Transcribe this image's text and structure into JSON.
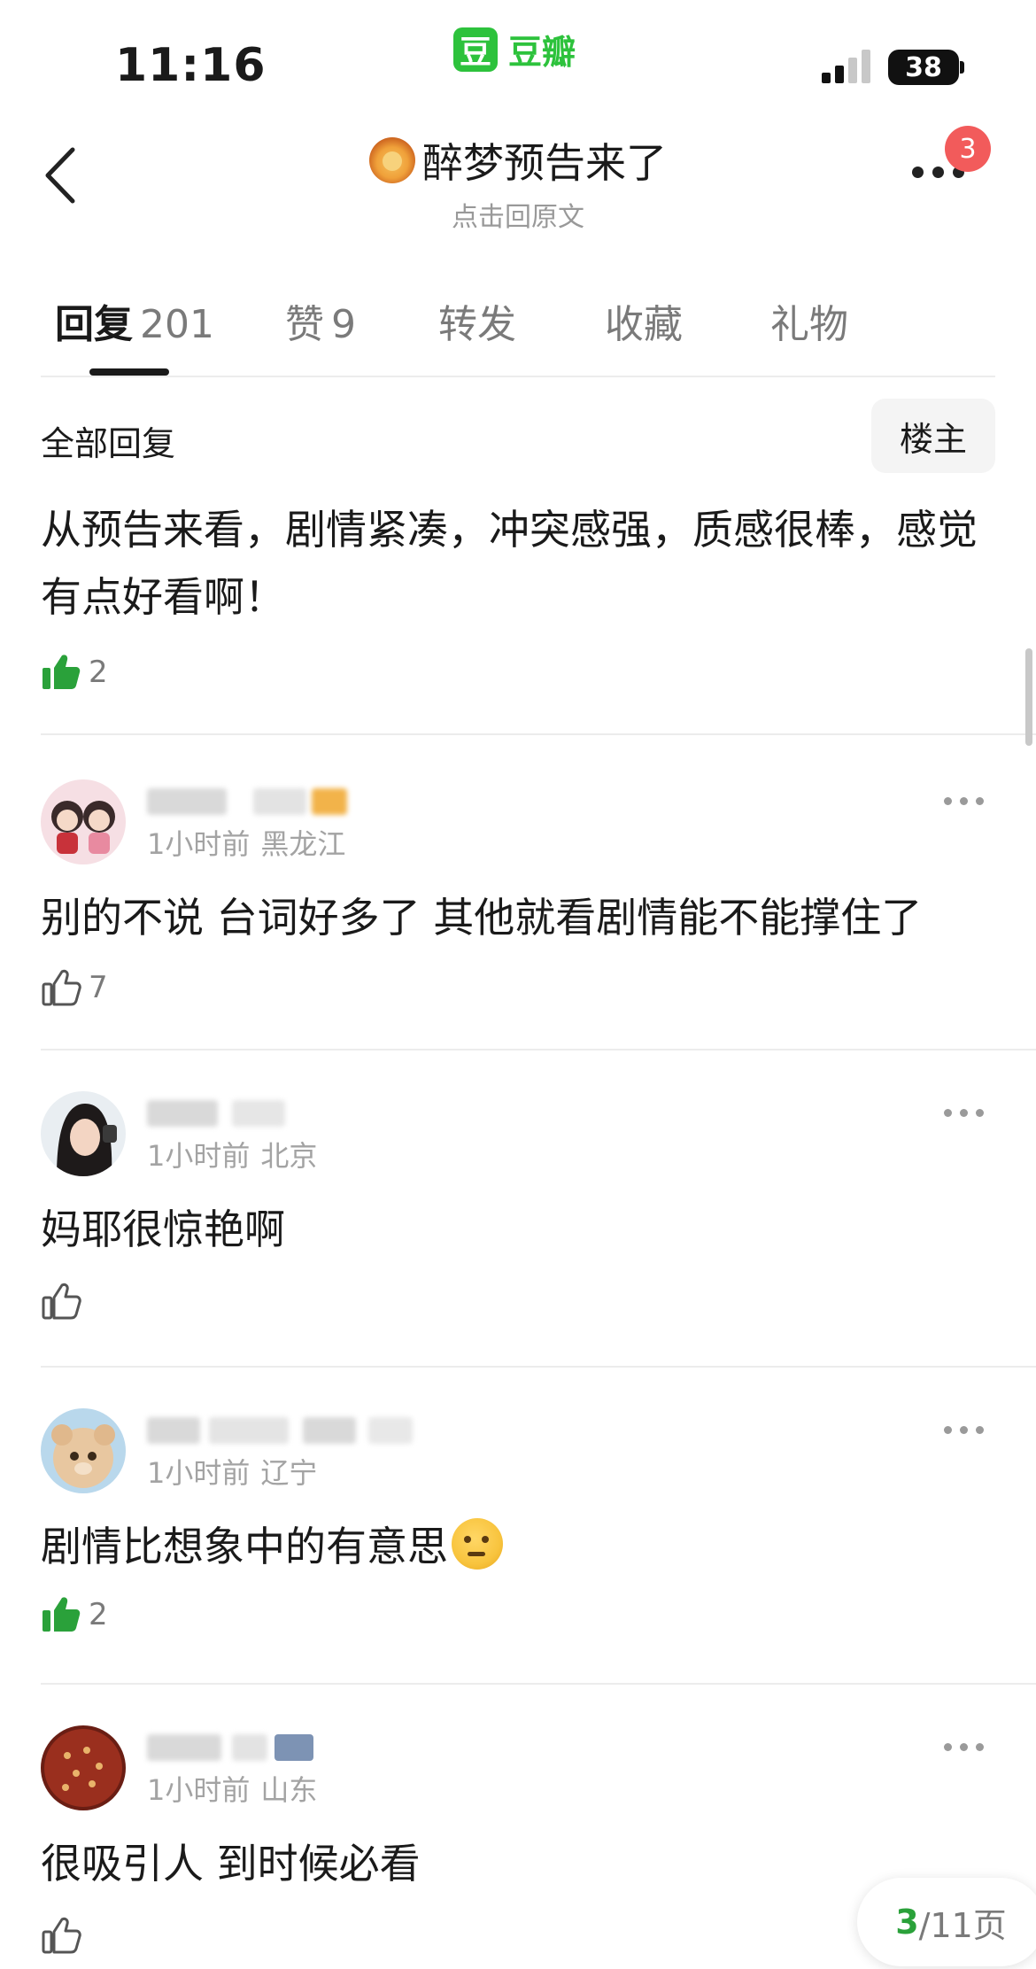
{
  "status_bar": {
    "time": "11:16",
    "app_name": "豆瓣",
    "app_logo_char": "豆",
    "battery": "38",
    "brand_color": "#2dc23c"
  },
  "header": {
    "title": "醉梦预告来了",
    "title_emoji": "lion-icon",
    "subtitle": "点击回原文",
    "notification_count": "3"
  },
  "tabs": [
    {
      "label": "回复",
      "count": "201",
      "active": true
    },
    {
      "label": "赞",
      "count": "9",
      "active": false
    },
    {
      "label": "转发",
      "count": "",
      "active": false
    },
    {
      "label": "收藏",
      "count": "",
      "active": false
    },
    {
      "label": "礼物",
      "count": "",
      "active": false
    }
  ],
  "filter": {
    "label": "全部回复",
    "op_button": "楼主"
  },
  "first_comment": {
    "text": "从预告来看，剧情紧凑，冲突感强，质感很棒，感觉有点好看啊！",
    "likes": "2",
    "liked": true
  },
  "comments": [
    {
      "time": "1小时前",
      "location": "黑龙江",
      "text": "别的不说  台词好多了 其他就看剧情能不能撑住了",
      "likes": "7",
      "liked": false
    },
    {
      "time": "1小时前",
      "location": "北京",
      "text": "妈耶很惊艳啊",
      "likes": "",
      "liked": false
    },
    {
      "time": "1小时前",
      "location": "辽宁",
      "text": "剧情比想象中的有意思",
      "emoji": "thinking-face-icon",
      "likes": "2",
      "liked": true
    },
    {
      "time": "1小时前",
      "location": "山东",
      "text": "很吸引人 到时候必看",
      "likes": "",
      "liked": false
    }
  ],
  "pager": {
    "current": "3",
    "total": "/11页",
    "current_color": "#2aa13a"
  },
  "colors": {
    "like_active": "#2aa13a",
    "badge": "#f25b5b",
    "divider": "#ececec"
  }
}
